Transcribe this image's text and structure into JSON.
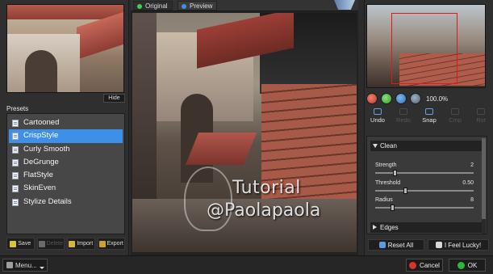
{
  "left_panel": {
    "hide_label": "Hide",
    "presets_label": "Presets",
    "presets": [
      {
        "label": "Cartooned"
      },
      {
        "label": "CrispStyle",
        "selected": true
      },
      {
        "label": "Curly Smooth"
      },
      {
        "label": "DeGrunge"
      },
      {
        "label": "FlatStyle"
      },
      {
        "label": "SkinEven"
      },
      {
        "label": "Stylize Details"
      }
    ],
    "buttons": {
      "save": "Save",
      "delete": "Delete",
      "import": "Import",
      "export": "Export"
    }
  },
  "preview": {
    "tabs": {
      "original": "Original",
      "preview": "Preview"
    },
    "watermark_line1": "Tutorial",
    "watermark_line2": "@Paolapaola"
  },
  "right_panel": {
    "zoom": "100.0%",
    "history": {
      "undo": "Undo",
      "redo": "Redo",
      "snap": "Snap",
      "compare": "Cmp",
      "restore": "Rst"
    },
    "sections": {
      "clean": "Clean",
      "edges": "Edges"
    },
    "params": {
      "strength": {
        "label": "Strength",
        "value": "2",
        "fraction": 0.2
      },
      "threshold": {
        "label": "Threshold",
        "value": "0.50",
        "fraction": 0.3
      },
      "radius": {
        "label": "Radius",
        "value": "8",
        "fraction": 0.17
      }
    },
    "actions": {
      "reset_all": "Reset All",
      "feel_lucky": "I Feel Lucky!"
    }
  },
  "bottom_bar": {
    "menu": "Menu...",
    "cancel": "Cancel",
    "ok": "OK"
  },
  "colors": {
    "selection": "#3d8fe8",
    "nav_frame": "#e01a1a",
    "ok_icon": "#2fb632",
    "cancel_icon": "#d8342a"
  }
}
